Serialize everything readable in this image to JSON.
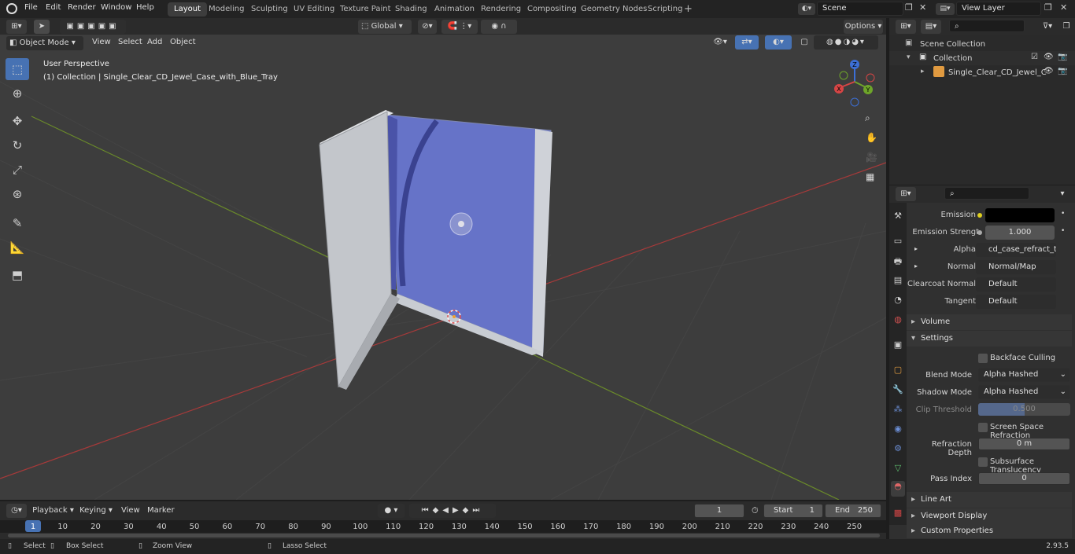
{
  "top_menu": [
    "File",
    "Edit",
    "Render",
    "Window",
    "Help"
  ],
  "workspaces": [
    "Layout",
    "Modeling",
    "Sculpting",
    "UV Editing",
    "Texture Paint",
    "Shading",
    "Animation",
    "Rendering",
    "Compositing",
    "Geometry Nodes",
    "Scripting"
  ],
  "active_workspace": "Layout",
  "scene_name": "Scene",
  "view_layer": "View Layer",
  "viewport_header": {
    "transform_orientation": "Global",
    "options_label": "Options",
    "mode": "Object Mode",
    "menus": [
      "View",
      "Select",
      "Add",
      "Object"
    ]
  },
  "viewport": {
    "perspective_label": "User Perspective",
    "collection_label": "(1) Collection | Single_Clear_CD_Jewel_Case_with_Blue_Tray",
    "gizmo_axes": [
      "Z",
      "X",
      "Y"
    ]
  },
  "outliner": {
    "items": [
      {
        "label": "Scene Collection"
      },
      {
        "label": "Collection"
      },
      {
        "label": "Single_Clear_CD_Jewel_C"
      }
    ]
  },
  "properties": {
    "rows": [
      {
        "label": "Emission",
        "value": ""
      },
      {
        "label": "Emission Strengt",
        "value": "1.000"
      },
      {
        "label": "Alpha",
        "value": "cd_case_refract_tran..."
      },
      {
        "label": "Normal",
        "value": "Normal/Map"
      },
      {
        "label": "Clearcoat Normal",
        "value": "Default"
      },
      {
        "label": "Tangent",
        "value": "Default"
      }
    ],
    "sections": {
      "volume": "Volume",
      "settings": "Settings",
      "line_art": "Line Art",
      "viewport_display": "Viewport Display",
      "custom_properties": "Custom Properties"
    },
    "settings": {
      "backface_culling": "Backface Culling",
      "blend_mode_label": "Blend Mode",
      "blend_mode": "Alpha Hashed",
      "shadow_mode_label": "Shadow Mode",
      "shadow_mode": "Alpha Hashed",
      "clip_threshold_label": "Clip Threshold",
      "clip_threshold": "0.500",
      "ssr_label": "Screen Space Refraction",
      "refraction_depth_label": "Refraction Depth",
      "refraction_depth": "0 m",
      "subsurface_label": "Subsurface Translucency",
      "pass_index_label": "Pass Index",
      "pass_index": "0"
    }
  },
  "timeline": {
    "menus": [
      "Playback",
      "Keying",
      "View",
      "Marker"
    ],
    "current_frame": "1",
    "start_label": "Start",
    "start": "1",
    "end_label": "End",
    "end": "250",
    "ticks": [
      "1",
      "10",
      "20",
      "30",
      "40",
      "50",
      "60",
      "70",
      "80",
      "90",
      "100",
      "110",
      "120",
      "130",
      "140",
      "150",
      "160",
      "170",
      "180",
      "190",
      "200",
      "210",
      "220",
      "230",
      "240",
      "250"
    ]
  },
  "statusbar": {
    "items": [
      "Select",
      "Box Select",
      "Zoom View",
      "Lasso Select"
    ],
    "version": "2.93.5"
  },
  "colors": {
    "accent": "#4772b3",
    "tray_blue": "#6673c8",
    "grid_x": "#a63a3a",
    "grid_y": "#6a8a2a"
  }
}
